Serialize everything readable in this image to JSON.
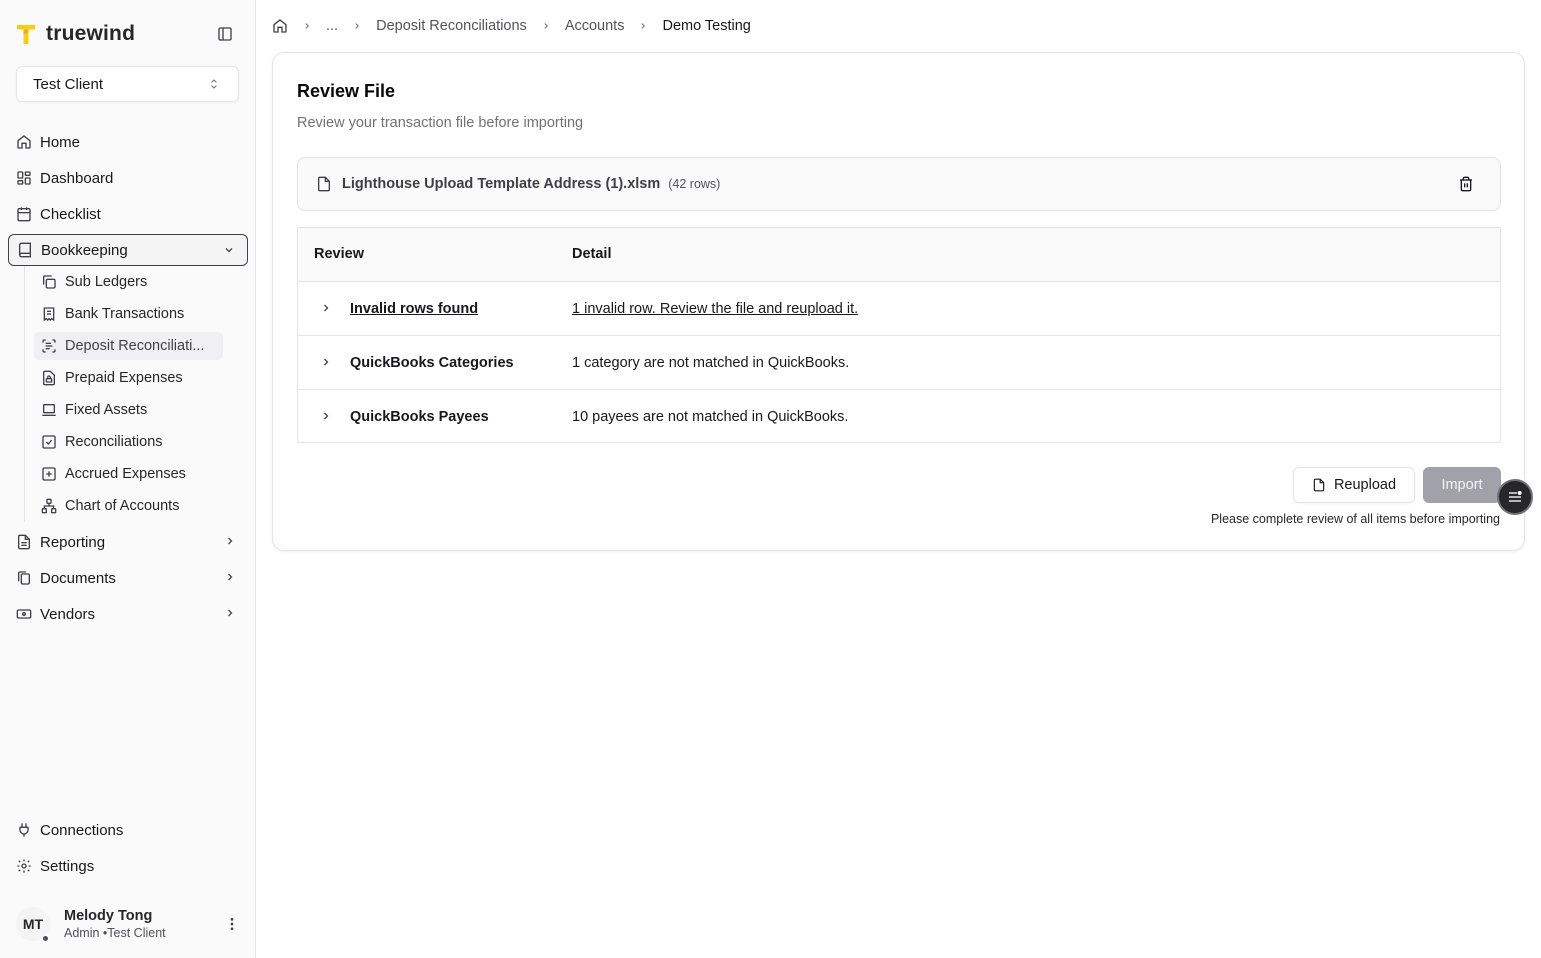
{
  "app": {
    "brand_name": "truewind",
    "accent_color": "#FACC15"
  },
  "client_select": {
    "value": "Test Client"
  },
  "nav": {
    "home": "Home",
    "dashboard": "Dashboard",
    "checklist": "Checklist",
    "bookkeeping": "Bookkeeping",
    "reporting": "Reporting",
    "documents": "Documents",
    "vendors": "Vendors",
    "connections": "Connections",
    "settings": "Settings"
  },
  "bookkeeping_sub": [
    {
      "label": "Sub Ledgers",
      "icon": "copy-icon"
    },
    {
      "label": "Bank Transactions",
      "icon": "receipt-icon"
    },
    {
      "label": "Deposit Reconciliati...",
      "icon": "scan-text-icon"
    },
    {
      "label": "Prepaid Expenses",
      "icon": "file-lock-icon"
    },
    {
      "label": "Fixed Assets",
      "icon": "laptop-icon"
    },
    {
      "label": "Reconciliations",
      "icon": "square-check-icon"
    },
    {
      "label": "Accrued Expenses",
      "icon": "square-plus-icon"
    },
    {
      "label": "Chart of Accounts",
      "icon": "network-icon"
    }
  ],
  "user": {
    "initials": "MT",
    "name": "Melody Tong",
    "role": "Admin •Test Client"
  },
  "breadcrumb": {
    "ellipsis": "...",
    "items": [
      "Deposit Reconciliations",
      "Accounts"
    ],
    "current": "Demo Testing"
  },
  "review": {
    "title": "Review File",
    "subtitle": "Review your transaction file before importing",
    "file_name": "Lighthouse Upload Template Address (1).xlsm",
    "file_rows": "(42 rows)",
    "columns": [
      "Review",
      "Detail"
    ],
    "rows": [
      {
        "review": "Invalid rows found",
        "detail": "1 invalid row. Review the file and reupload it."
      },
      {
        "review": "QuickBooks Categories",
        "detail": "1 category are not matched in QuickBooks."
      },
      {
        "review": "QuickBooks Payees",
        "detail": "10 payees are not matched in QuickBooks."
      }
    ],
    "reupload_label": "Reupload",
    "import_label": "Import",
    "hint": "Please complete review of all items before importing"
  }
}
